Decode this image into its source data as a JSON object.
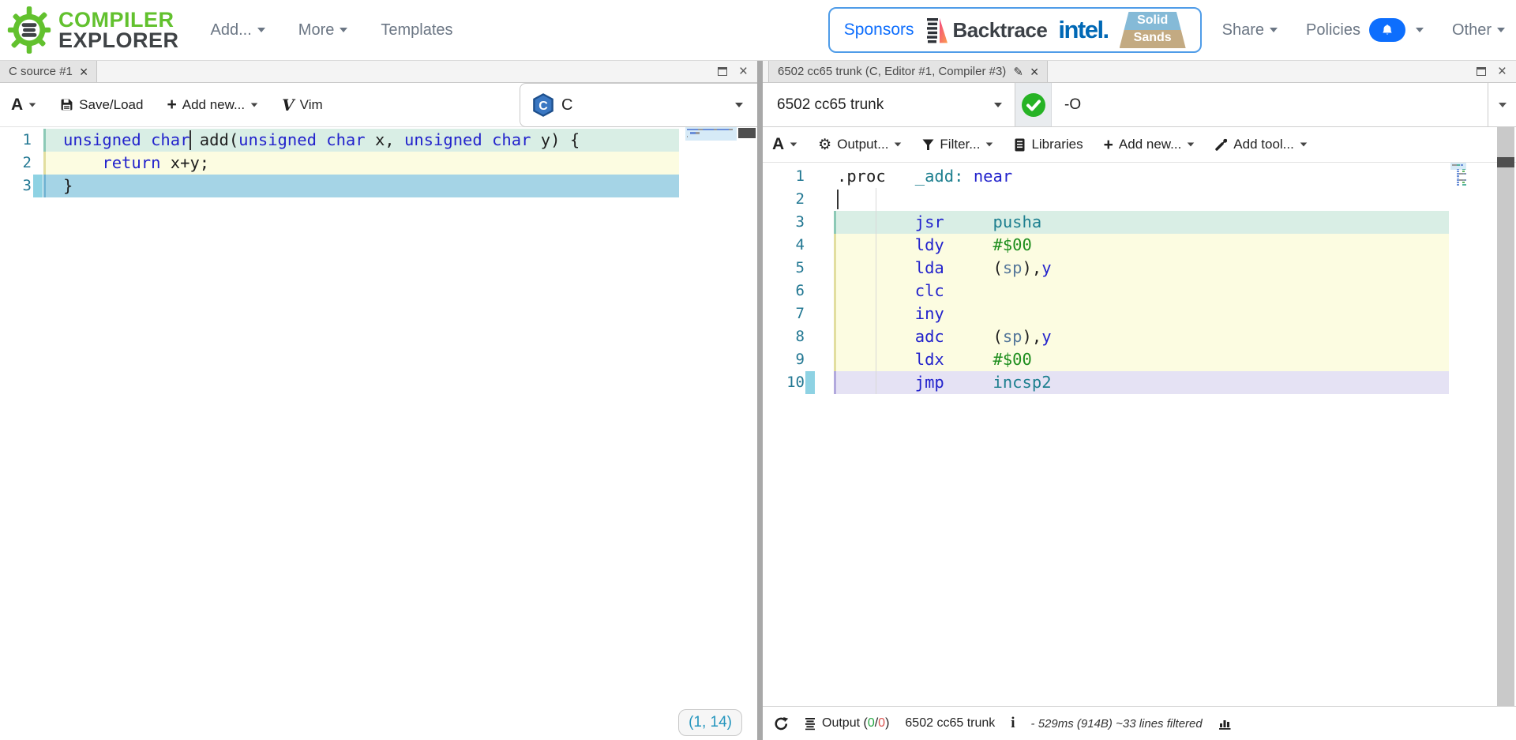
{
  "header": {
    "logo_line1": "COMPILER",
    "logo_line2": "EXPLORER",
    "nav": [
      {
        "label": "Add..."
      },
      {
        "label": "More"
      },
      {
        "label": "Templates"
      }
    ],
    "sponsors_label": "Sponsors",
    "sponsor_backtrace": "Backtrace",
    "sponsor_intel": "intel.",
    "sponsor_solid_top": "Solid",
    "sponsor_solid_bottom": "Sands",
    "share_label": "Share",
    "policies_label": "Policies",
    "other_label": "Other"
  },
  "icons": {
    "close": "×",
    "pencil": "✎",
    "gear": "⚙",
    "plus": "+",
    "info": "i",
    "vim_v": "V"
  },
  "left_pane": {
    "tab_title": "C source #1",
    "toolbar": {
      "font_label": "A",
      "saveload_label": "Save/Load",
      "addnew_label": "Add new...",
      "vim_label": "Vim"
    },
    "language_label": "C",
    "position_badge": "(1, 14)",
    "editor": {
      "cursor": {
        "line": 1,
        "col": 13
      },
      "lines": [
        {
          "num": "1",
          "bg": "teal",
          "marker": false,
          "segs": [
            [
              "k",
              "unsigned char"
            ],
            [
              "p",
              " add("
            ],
            [
              "k",
              "unsigned char"
            ],
            [
              "p",
              " x, "
            ],
            [
              "k",
              "unsigned char"
            ],
            [
              "p",
              " y) {"
            ]
          ]
        },
        {
          "num": "2",
          "bg": "yellow",
          "marker": false,
          "segs": [
            [
              "p",
              "    "
            ],
            [
              "k",
              "return"
            ],
            [
              "p",
              " x+y;"
            ]
          ]
        },
        {
          "num": "3",
          "bg": "blue",
          "marker": true,
          "segs": [
            [
              "p",
              "}"
            ]
          ]
        }
      ]
    }
  },
  "right_pane": {
    "tab_title": "6502 cc65 trunk (C, Editor #1, Compiler #3)",
    "compiler_name": "6502 cc65 trunk",
    "options_value": "-O",
    "toolbar": {
      "font_label": "A",
      "output_label": "Output...",
      "filter_label": "Filter...",
      "libraries_label": "Libraries",
      "addnew_label": "Add new...",
      "addtool_label": "Add tool..."
    },
    "editor": {
      "cursor": {
        "line": 2,
        "col": 0
      },
      "lines": [
        {
          "num": "1",
          "bg": "none",
          "marker": false,
          "segs": [
            [
              "p",
              ".proc   "
            ],
            [
              "t",
              "_add:"
            ],
            [
              "p",
              " "
            ],
            [
              "k",
              "near"
            ]
          ]
        },
        {
          "num": "2",
          "bg": "none",
          "marker": false,
          "segs": []
        },
        {
          "num": "3",
          "bg": "teal",
          "marker": false,
          "segs": [
            [
              "p",
              "        "
            ],
            [
              "k",
              "jsr"
            ],
            [
              "p",
              "     "
            ],
            [
              "t",
              "pusha"
            ]
          ]
        },
        {
          "num": "4",
          "bg": "yellow",
          "marker": false,
          "segs": [
            [
              "p",
              "        "
            ],
            [
              "k",
              "ldy"
            ],
            [
              "p",
              "     "
            ],
            [
              "g",
              "#$00"
            ]
          ]
        },
        {
          "num": "5",
          "bg": "yellow",
          "marker": false,
          "segs": [
            [
              "p",
              "        "
            ],
            [
              "k",
              "lda"
            ],
            [
              "p",
              "     ("
            ],
            [
              "v",
              "sp"
            ],
            [
              "p",
              "),"
            ],
            [
              "k",
              "y"
            ]
          ]
        },
        {
          "num": "6",
          "bg": "yellow",
          "marker": false,
          "segs": [
            [
              "p",
              "        "
            ],
            [
              "k",
              "clc"
            ]
          ]
        },
        {
          "num": "7",
          "bg": "yellow",
          "marker": false,
          "segs": [
            [
              "p",
              "        "
            ],
            [
              "k",
              "iny"
            ]
          ]
        },
        {
          "num": "8",
          "bg": "yellow",
          "marker": false,
          "segs": [
            [
              "p",
              "        "
            ],
            [
              "k",
              "adc"
            ],
            [
              "p",
              "     ("
            ],
            [
              "v",
              "sp"
            ],
            [
              "p",
              "),"
            ],
            [
              "k",
              "y"
            ]
          ]
        },
        {
          "num": "9",
          "bg": "yellow",
          "marker": false,
          "segs": [
            [
              "p",
              "        "
            ],
            [
              "k",
              "ldx"
            ],
            [
              "p",
              "     "
            ],
            [
              "g",
              "#$00"
            ]
          ]
        },
        {
          "num": "10",
          "bg": "lavender",
          "marker": true,
          "segs": [
            [
              "p",
              "        "
            ],
            [
              "k",
              "jmp"
            ],
            [
              "p",
              "     "
            ],
            [
              "t",
              "incsp2"
            ]
          ]
        }
      ]
    },
    "status": {
      "output_label": "Output",
      "paren_open": "(",
      "pass_count": "0",
      "separator": "/",
      "fail_count": "0",
      "paren_close": ")",
      "compiler_name": "6502 cc65 trunk",
      "timing_text": "- 529ms (914B) ~33 lines filtered"
    }
  }
}
